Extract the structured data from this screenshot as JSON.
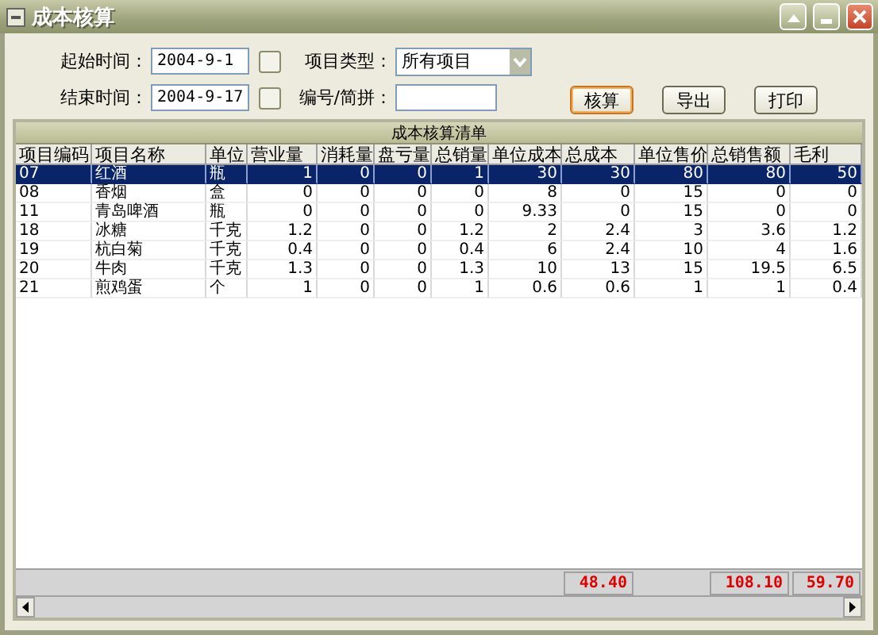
{
  "window": {
    "title": "成本核算"
  },
  "filters": {
    "start_label": "起始时间：",
    "start_value": "2004-9-1",
    "end_label": "结束时间：",
    "end_value": "2004-9-17",
    "type_label": "项目类型：",
    "type_value": "所有项目",
    "code_label": "编号/简拼："
  },
  "buttons": [
    {
      "label": "核算",
      "default": true
    },
    {
      "label": "导出",
      "default": false
    },
    {
      "label": "打印",
      "default": false
    }
  ],
  "table": {
    "title": "成本核算清单",
    "columns": [
      "项目编码",
      "项目名称",
      "单位",
      "营业量",
      "消耗量",
      "盘亏量",
      "总销量",
      "单位成本",
      "总成本",
      "单位售价",
      "总销售额",
      "毛利"
    ],
    "rows": [
      {
        "selected": true,
        "cells": [
          "07",
          "红酒",
          "瓶",
          "1",
          "0",
          "0",
          "1",
          "30",
          "30",
          "80",
          "80",
          "50"
        ]
      },
      {
        "selected": false,
        "cells": [
          "08",
          "香烟",
          "盒",
          "0",
          "0",
          "0",
          "0",
          "8",
          "0",
          "15",
          "0",
          "0"
        ]
      },
      {
        "selected": false,
        "cells": [
          "11",
          "青岛啤酒",
          "瓶",
          "0",
          "0",
          "0",
          "0",
          "9.33",
          "0",
          "15",
          "0",
          "0"
        ]
      },
      {
        "selected": false,
        "cells": [
          "18",
          "冰糖",
          "千克",
          "1.2",
          "0",
          "0",
          "1.2",
          "2",
          "2.4",
          "3",
          "3.6",
          "1.2"
        ]
      },
      {
        "selected": false,
        "cells": [
          "19",
          "杭白菊",
          "千克",
          "0.4",
          "0",
          "0",
          "0.4",
          "6",
          "2.4",
          "10",
          "4",
          "1.6"
        ]
      },
      {
        "selected": false,
        "cells": [
          "20",
          "牛肉",
          "千克",
          "1.3",
          "0",
          "0",
          "1.3",
          "10",
          "13",
          "15",
          "19.5",
          "6.5"
        ]
      },
      {
        "selected": false,
        "cells": [
          "21",
          "煎鸡蛋",
          "个",
          "1",
          "0",
          "0",
          "1",
          "0.6",
          "0.6",
          "1",
          "1",
          "0.4"
        ]
      }
    ],
    "totals": {
      "total_cost": "48.40",
      "total_sales": "108.10",
      "gross_profit": "59.70"
    }
  }
}
